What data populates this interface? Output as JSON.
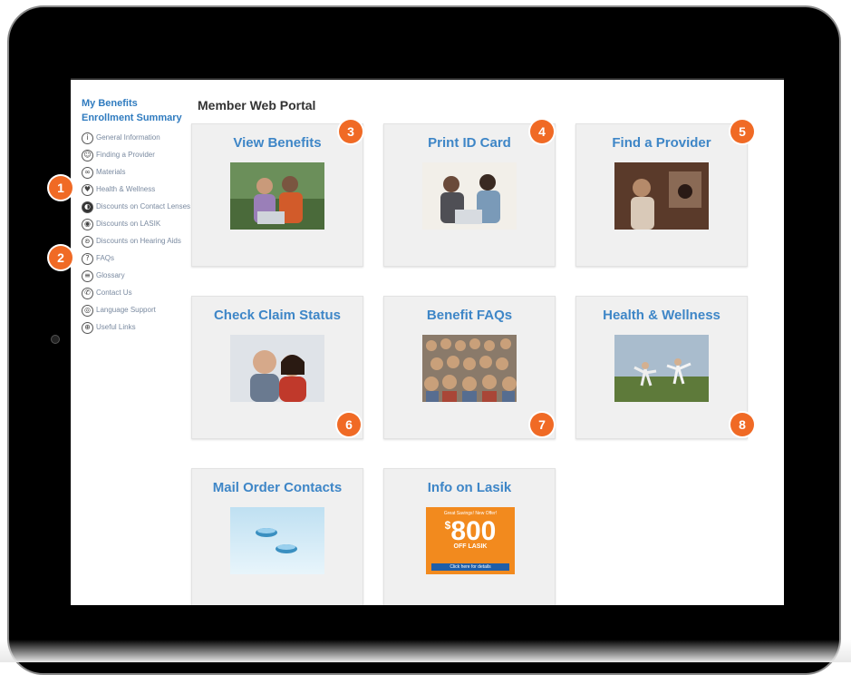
{
  "sidebar": {
    "heading1": "My Benefits",
    "heading2": "Enrollment Summary",
    "items": [
      {
        "label": "General Information",
        "icon": "info-icon"
      },
      {
        "label": "Finding a Provider",
        "icon": "provider-icon"
      },
      {
        "label": "Materials",
        "icon": "glasses-icon"
      },
      {
        "label": "Health & Wellness",
        "icon": "wellness-icon"
      },
      {
        "label": "Discounts on Contact Lenses",
        "icon": "contact-lens-icon"
      },
      {
        "label": "Discounts on LASIK",
        "icon": "eye-icon"
      },
      {
        "label": "Discounts on Hearing Aids",
        "icon": "hearing-icon"
      },
      {
        "label": "FAQs",
        "icon": "question-icon"
      },
      {
        "label": "Glossary",
        "icon": "book-icon"
      },
      {
        "label": "Contact Us",
        "icon": "phone-icon"
      },
      {
        "label": "Language Support",
        "icon": "language-icon"
      },
      {
        "label": "Useful Links",
        "icon": "link-icon"
      }
    ]
  },
  "page_title": "Member Web Portal",
  "tiles": [
    {
      "title": "View Benefits"
    },
    {
      "title": "Print ID Card"
    },
    {
      "title": "Find a Provider"
    },
    {
      "title": "Check Claim Status"
    },
    {
      "title": "Benefit FAQs"
    },
    {
      "title": "Health & Wellness"
    },
    {
      "title": "Mail Order Contacts"
    },
    {
      "title": "Info on Lasik"
    }
  ],
  "lasik_promo": {
    "line1": "Great Savings! New Offer!",
    "currency": "$",
    "amount": "800",
    "line3": "OFF LASIK",
    "line4": "Click here for details"
  },
  "badges": [
    "1",
    "2",
    "3",
    "4",
    "5",
    "6",
    "7",
    "8"
  ],
  "colors": {
    "accent": "#3e86c7",
    "badge": "#f06a25",
    "tile_bg": "#f0f0f0",
    "device": "#000000"
  }
}
